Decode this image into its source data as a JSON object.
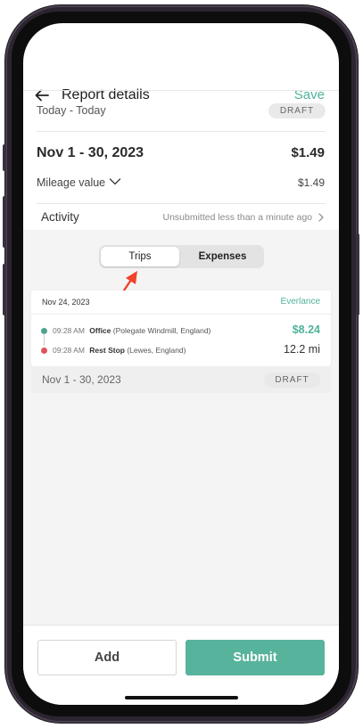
{
  "header": {
    "title": "Report details",
    "save_label": "Save"
  },
  "report": {
    "date_range": "Today - Today",
    "status_badge": "DRAFT",
    "period": "Nov 1 - 30, 2023",
    "total": "$1.49",
    "mileage_label": "Mileage value",
    "mileage_value": "$1.49"
  },
  "activity": {
    "label": "Activity",
    "status": "Unsubmitted less than a minute ago"
  },
  "tabs": {
    "trips_label": "Trips",
    "expenses_label": "Expenses",
    "selected": "Trips"
  },
  "trip": {
    "date": "Nov 24, 2023",
    "provider": "Everlance",
    "stops": [
      {
        "time": "09:28 AM",
        "name": "Office",
        "location": "(Polegate Windmill, England)"
      },
      {
        "time": "09:28 AM",
        "name": "Rest Stop",
        "location": "(Lewes, England)"
      }
    ],
    "amount": "$8.24",
    "distance": "12.2 mi"
  },
  "group": {
    "period": "Nov 1 - 30, 2023",
    "status_badge": "DRAFT"
  },
  "actions": {
    "add_label": "Add",
    "submit_label": "Submit"
  },
  "colors": {
    "accent": "#4fb39a",
    "submit_bg": "#58b39c",
    "annotation_arrow": "#f0432a",
    "origin_dot": "#4fa391",
    "destination_dot": "#e1535a"
  },
  "icons": {
    "back": "arrow-left-icon",
    "mileage_toggle": "chevron-down-icon",
    "activity_open": "chevron-right-icon",
    "annotation": "annotation-arrow-icon"
  }
}
